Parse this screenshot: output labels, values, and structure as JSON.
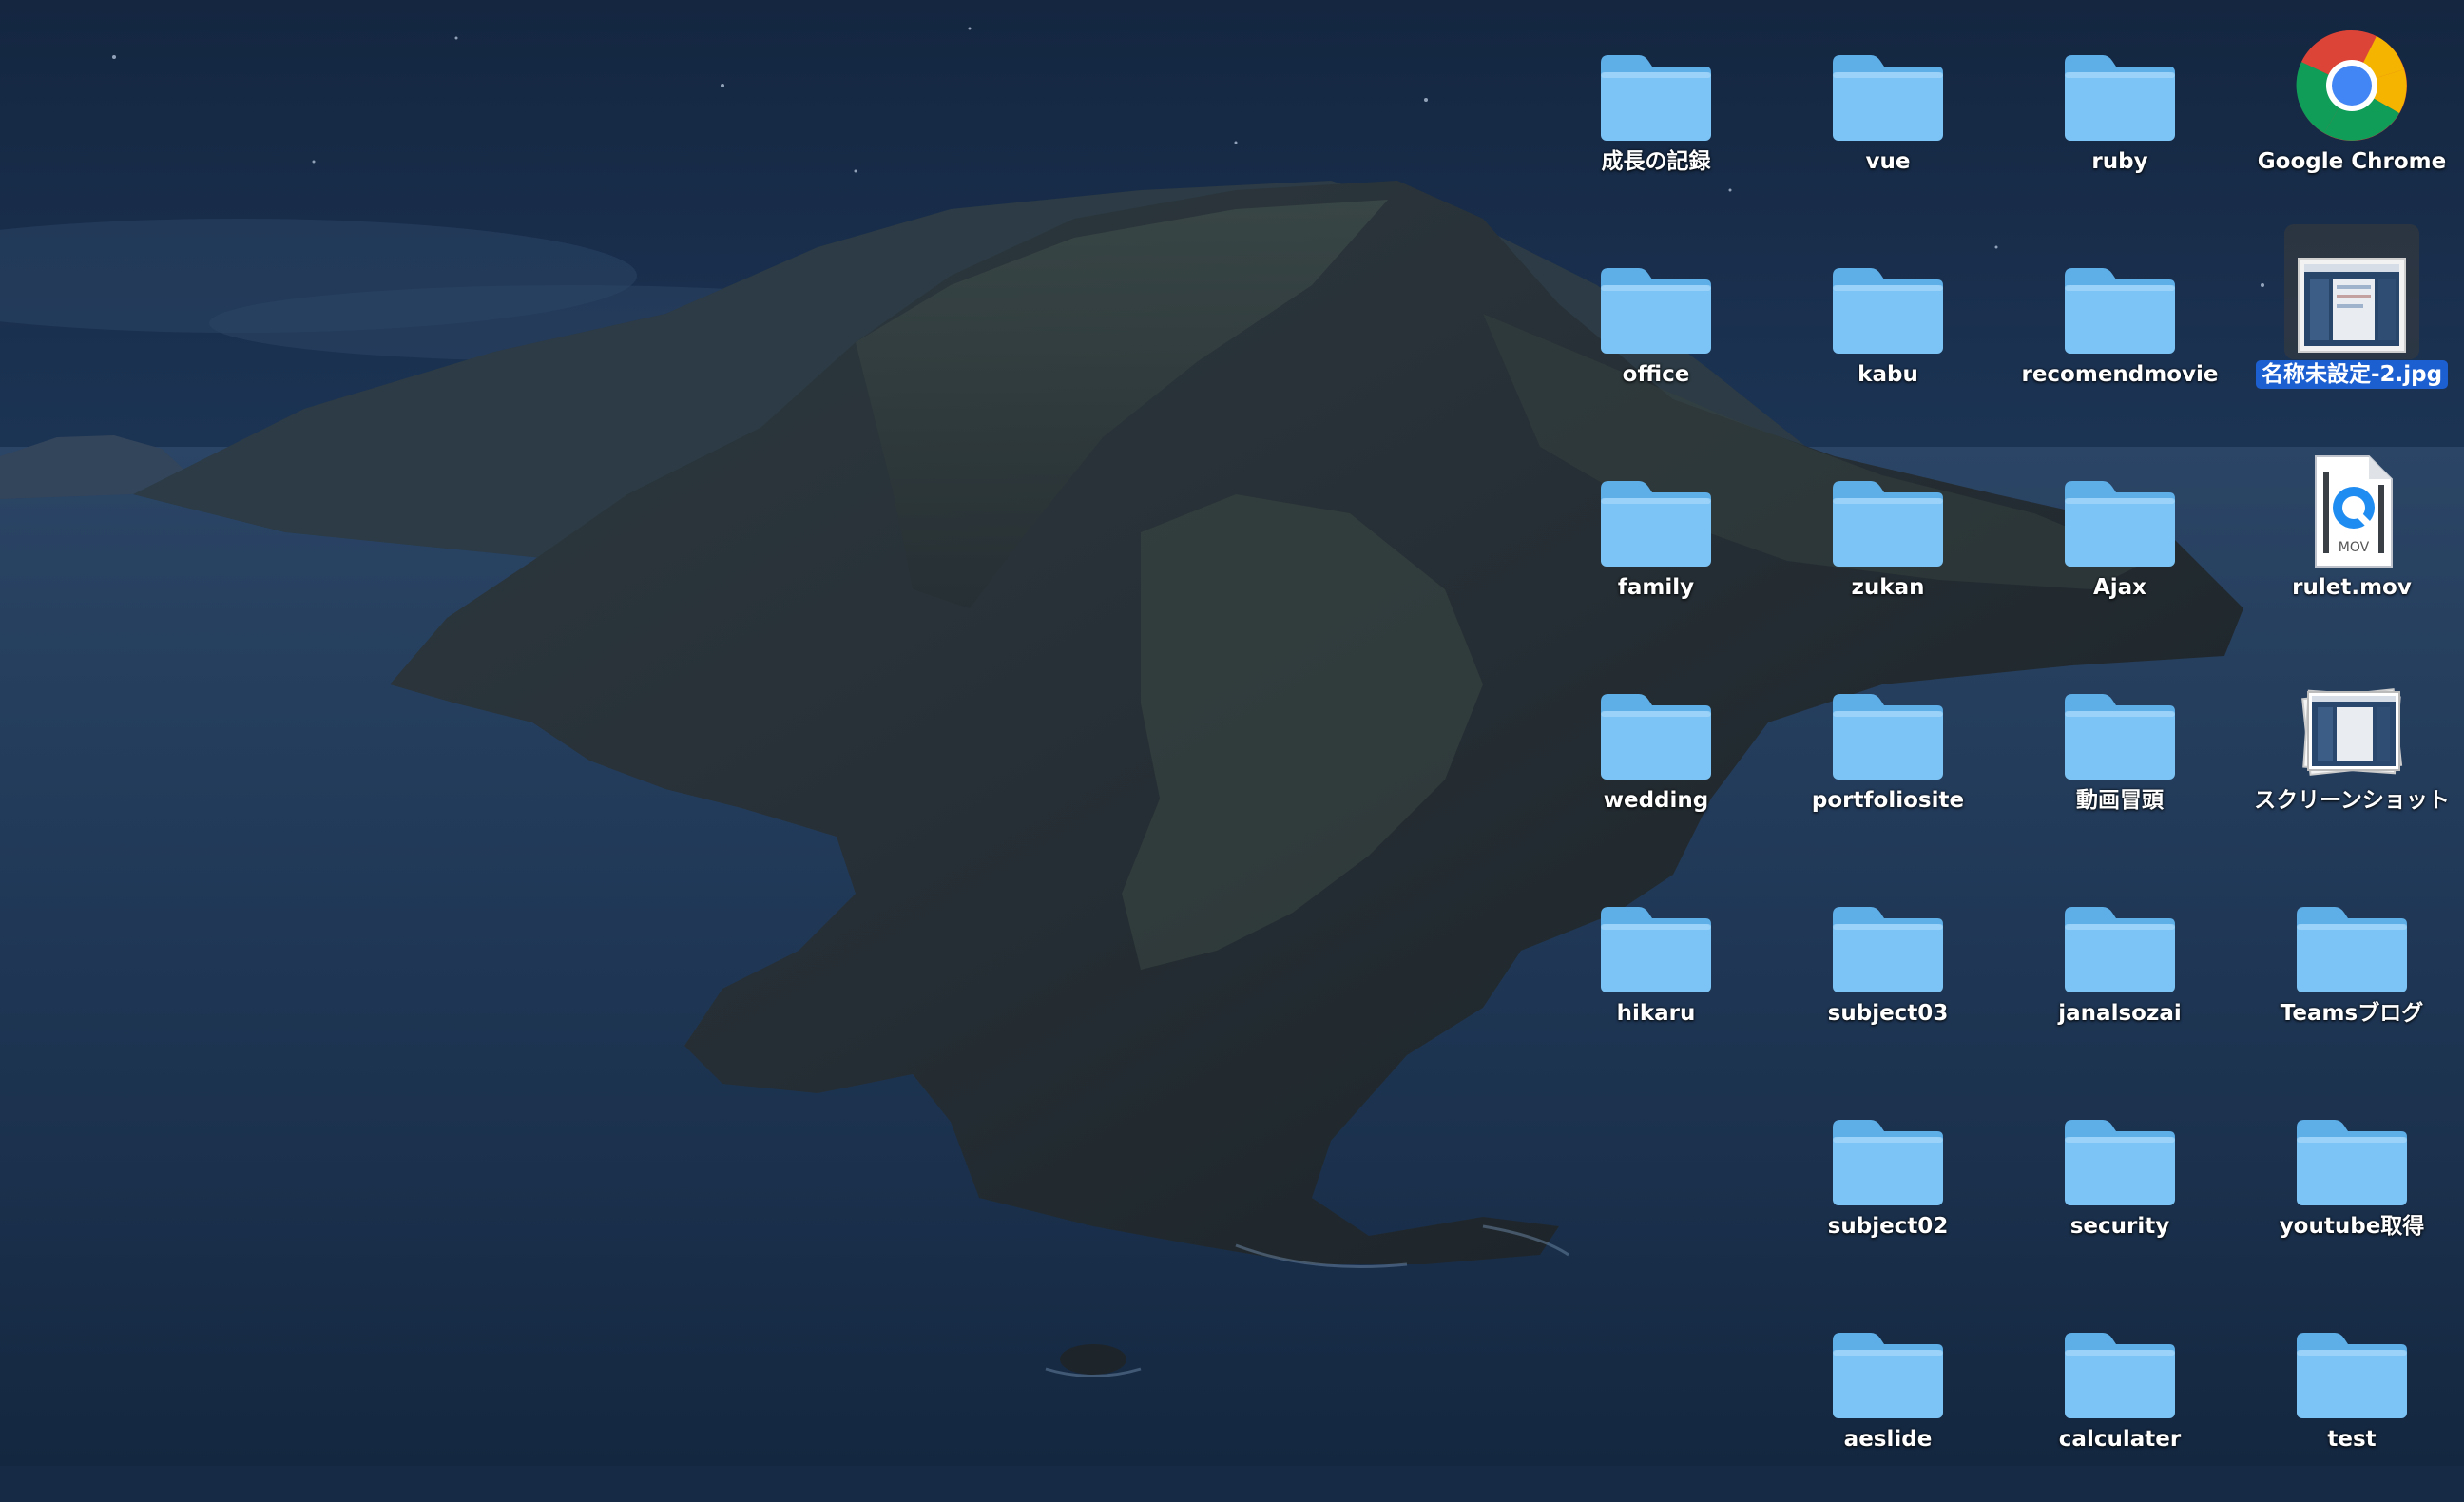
{
  "desktop": {
    "wallpaper": "macOS Catalina (night)",
    "selection_color": "#1c5fd1",
    "folder_color": "#7cc4f5",
    "columns": [
      {
        "items": [
          {
            "label": "成長の記録",
            "kind": "folder",
            "row": 0
          },
          {
            "label": "office",
            "kind": "folder",
            "row": 1
          },
          {
            "label": "family",
            "kind": "folder",
            "row": 2
          },
          {
            "label": "wedding",
            "kind": "folder",
            "row": 3
          },
          {
            "label": "hikaru",
            "kind": "folder",
            "row": 4
          }
        ]
      },
      {
        "items": [
          {
            "label": "vue",
            "kind": "folder",
            "row": 0
          },
          {
            "label": "kabu",
            "kind": "folder",
            "row": 1
          },
          {
            "label": "zukan",
            "kind": "folder",
            "row": 2
          },
          {
            "label": "portfoliosite",
            "kind": "folder",
            "row": 3
          },
          {
            "label": "subject03",
            "kind": "folder",
            "row": 4
          },
          {
            "label": "subject02",
            "kind": "folder",
            "row": 5
          },
          {
            "label": "aeslide",
            "kind": "folder",
            "row": 6
          }
        ]
      },
      {
        "items": [
          {
            "label": "ruby",
            "kind": "folder",
            "row": 0
          },
          {
            "label": "recomendmovie",
            "kind": "folder",
            "row": 1
          },
          {
            "label": "Ajax",
            "kind": "folder",
            "row": 2
          },
          {
            "label": "動画冒頭",
            "kind": "folder",
            "row": 3
          },
          {
            "label": "janalsozai",
            "kind": "folder",
            "row": 4
          },
          {
            "label": "security",
            "kind": "folder",
            "row": 5
          },
          {
            "label": "calculater",
            "kind": "folder",
            "row": 6
          }
        ]
      },
      {
        "items": [
          {
            "label": "Google Chrome",
            "kind": "chrome-app",
            "row": 0
          },
          {
            "label": "名称未設定-2.jpg",
            "kind": "image-file",
            "row": 1,
            "selected": true
          },
          {
            "label": "rulet.mov",
            "kind": "mov-file",
            "row": 2,
            "badge": "MOV"
          },
          {
            "label": "スクリーンショット",
            "kind": "screenshot-stack",
            "row": 3
          },
          {
            "label": "Teamsブログ",
            "kind": "folder",
            "row": 4
          },
          {
            "label": "youtube取得",
            "kind": "folder",
            "row": 5
          },
          {
            "label": "test",
            "kind": "folder",
            "row": 6
          }
        ]
      }
    ]
  }
}
